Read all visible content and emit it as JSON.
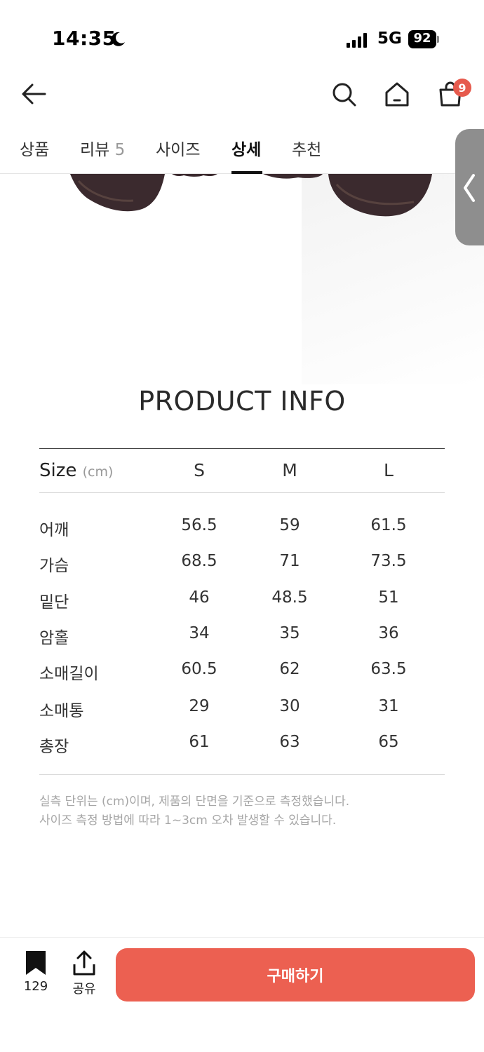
{
  "status_bar": {
    "time": "14:35",
    "network": "5G",
    "battery": "92"
  },
  "nav": {
    "cart_count": "9"
  },
  "tabs": [
    {
      "label": "상품",
      "count": ""
    },
    {
      "label": "리뷰",
      "count": "5"
    },
    {
      "label": "사이즈",
      "count": ""
    },
    {
      "label": "상세",
      "count": ""
    },
    {
      "label": "추천",
      "count": ""
    }
  ],
  "product_info": {
    "title": "PRODUCT INFO",
    "size_label": "Size",
    "unit_label": "(cm)",
    "columns": [
      "S",
      "M",
      "L"
    ],
    "rows": [
      {
        "label": "어깨",
        "values": [
          "56.5",
          "59",
          "61.5"
        ]
      },
      {
        "label": "가슴",
        "values": [
          "68.5",
          "71",
          "73.5"
        ]
      },
      {
        "label": "밑단",
        "values": [
          "46",
          "48.5",
          "51"
        ]
      },
      {
        "label": "암홀",
        "values": [
          "34",
          "35",
          "36"
        ]
      },
      {
        "label": "소매길이",
        "values": [
          "60.5",
          "62",
          "63.5"
        ]
      },
      {
        "label": "소매통",
        "values": [
          "29",
          "30",
          "31"
        ]
      },
      {
        "label": "총장",
        "values": [
          "61",
          "63",
          "65"
        ]
      }
    ],
    "notes": [
      "실측 단위는 (cm)이며, 제품의 단면을 기준으로 측정했습니다.",
      "사이즈 측정 방법에 따라 1~3cm 오차 발생할 수 있습니다."
    ]
  },
  "bottom_bar": {
    "bookmark_count": "129",
    "share_label": "공유",
    "buy_label": "구매하기"
  },
  "colors": {
    "accent": "#ec6051",
    "badge": "#e65a4d"
  }
}
